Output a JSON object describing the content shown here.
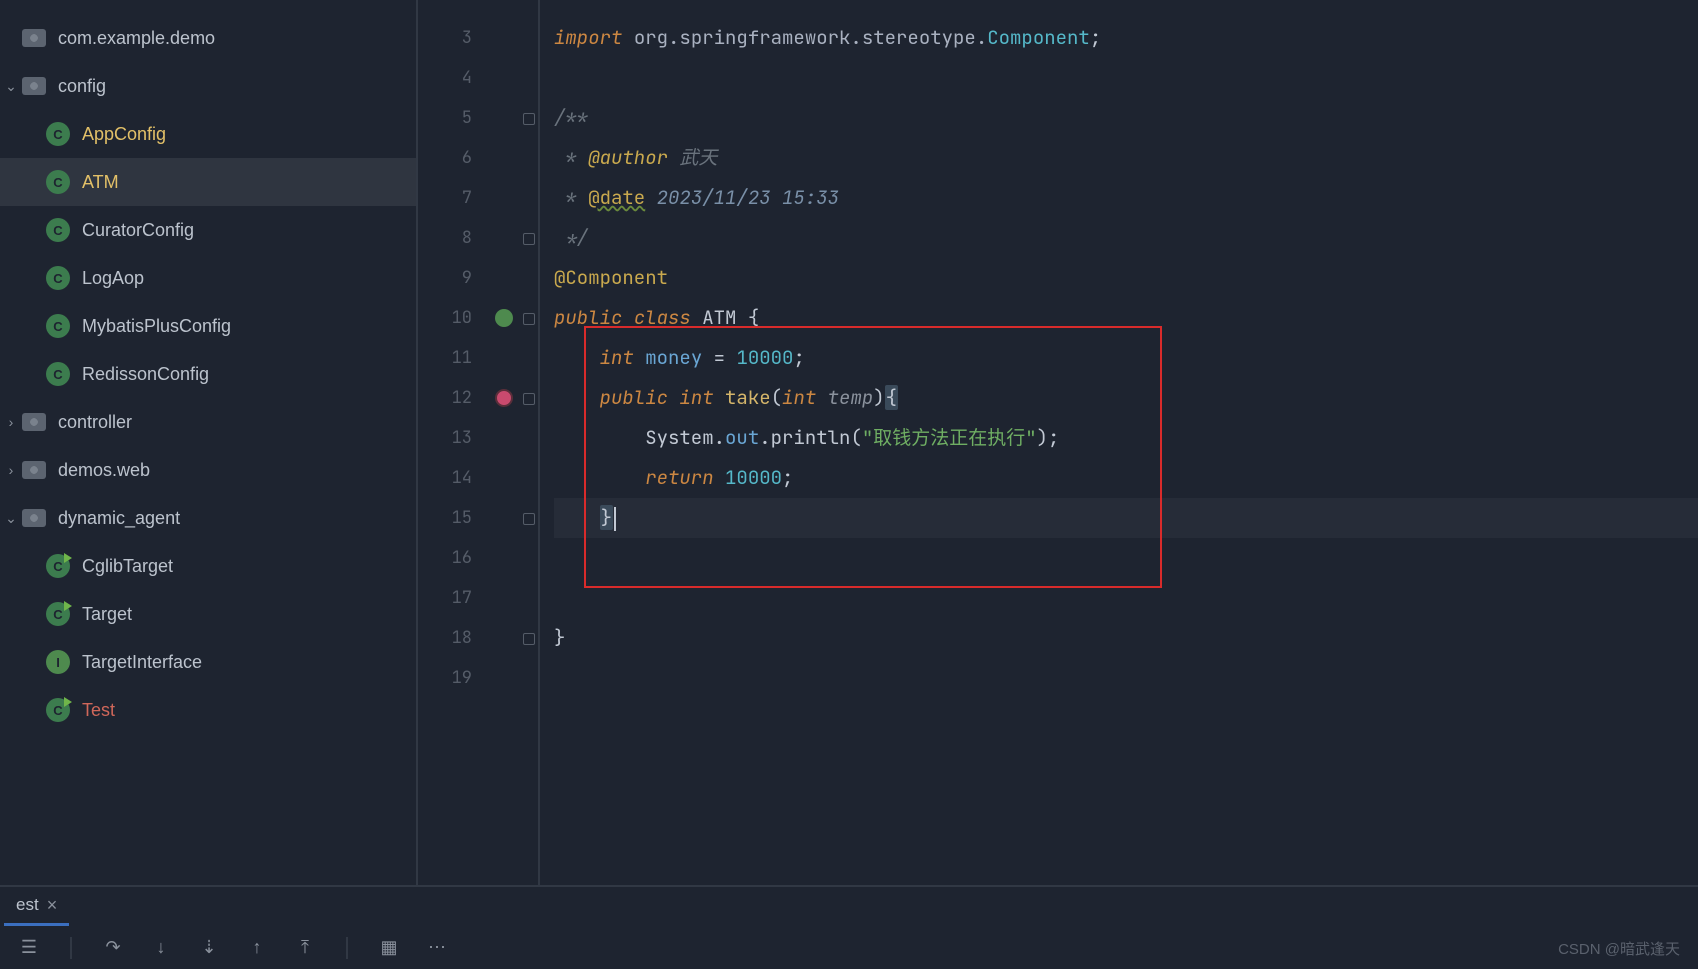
{
  "sidebar": {
    "root_pkg": "com.example.demo",
    "config": {
      "name": "config",
      "children": [
        "AppConfig",
        "ATM",
        "CuratorConfig",
        "LogAop",
        "MybatisPlusConfig",
        "RedissonConfig"
      ]
    },
    "controller": "controller",
    "demos_web": "demos.web",
    "dynamic_agent": {
      "name": "dynamic_agent",
      "children": [
        "CglibTarget",
        "Target",
        "TargetInterface",
        "Test"
      ]
    }
  },
  "line_numbers": [
    "3",
    "4",
    "5",
    "6",
    "7",
    "8",
    "9",
    "10",
    "11",
    "12",
    "13",
    "14",
    "15",
    "16",
    "17",
    "18",
    "19"
  ],
  "code": {
    "l3": {
      "import": "import ",
      "pkg": "org.springframework.stereotype.",
      "cls": "Component",
      "semi": ";"
    },
    "l5": "/**",
    "l6": {
      "star": " * ",
      "tag": "@author",
      "rest": " 武天"
    },
    "l7": {
      "star": " * ",
      "tag": "@date",
      "rest": " 2023/11/23 15:33"
    },
    "l8": " */",
    "l9": "@Component",
    "l10": {
      "pub": "public ",
      "cls": "class ",
      "name": "ATM ",
      "brace": "{"
    },
    "l11": {
      "indent": "    ",
      "type": "int ",
      "var": "money",
      "eq": " = ",
      "val": "10000",
      "semi": ";"
    },
    "l12": {
      "indent": "    ",
      "pub": "public ",
      "ret": "int ",
      "fn": "take",
      "open": "(",
      "ptype": "int ",
      "pname": "temp",
      "close": ")",
      "brace": "{"
    },
    "l13": {
      "indent": "        ",
      "sys": "System",
      "dot1": ".",
      "out": "out",
      "dot2": ".",
      "pl": "println",
      "open": "(",
      "str": "\"取钱方法正在执行\"",
      "close": ");"
    },
    "l14": {
      "indent": "        ",
      "ret": "return ",
      "val": "10000",
      "semi": ";"
    },
    "l15": {
      "indent": "    ",
      "brace": "}"
    },
    "l18": "}"
  },
  "bottom_tab": "est",
  "watermark": "CSDN @暗武逢天"
}
